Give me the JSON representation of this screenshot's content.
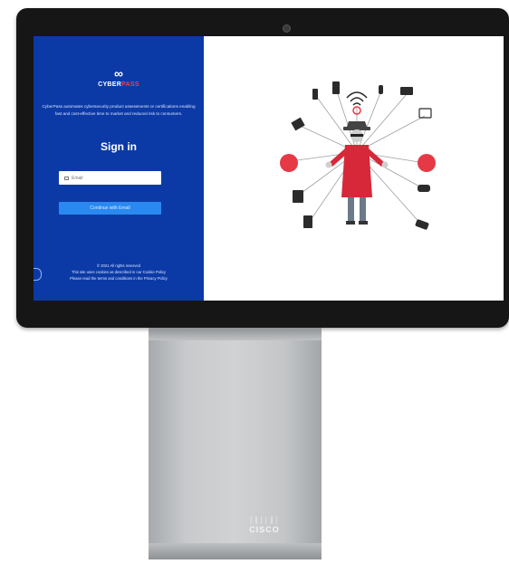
{
  "login": {
    "logo_icon": "∞",
    "brand_main": "CYBER",
    "brand_accent": "PASS",
    "tagline": "CyberPass automates cybersecurity product assessments or certifications enabling fast and cost-effective time to market and reduced risk to consumers.",
    "heading": "Sign in",
    "email_placeholder": "Email",
    "continue_label": "Continue with Email",
    "copyright": "© 2021 All rights reserved",
    "footer_line1": "This site uses cookies as described in our Cookie Policy",
    "footer_line2": "Please read the terms and conditions in the Privacy Policy"
  },
  "device": {
    "brand_mark": "│║││║│",
    "brand_name": "CISCO"
  },
  "colors": {
    "panel": "#0b3aa6",
    "button": "#2a89f0",
    "accent": "#e63946"
  }
}
